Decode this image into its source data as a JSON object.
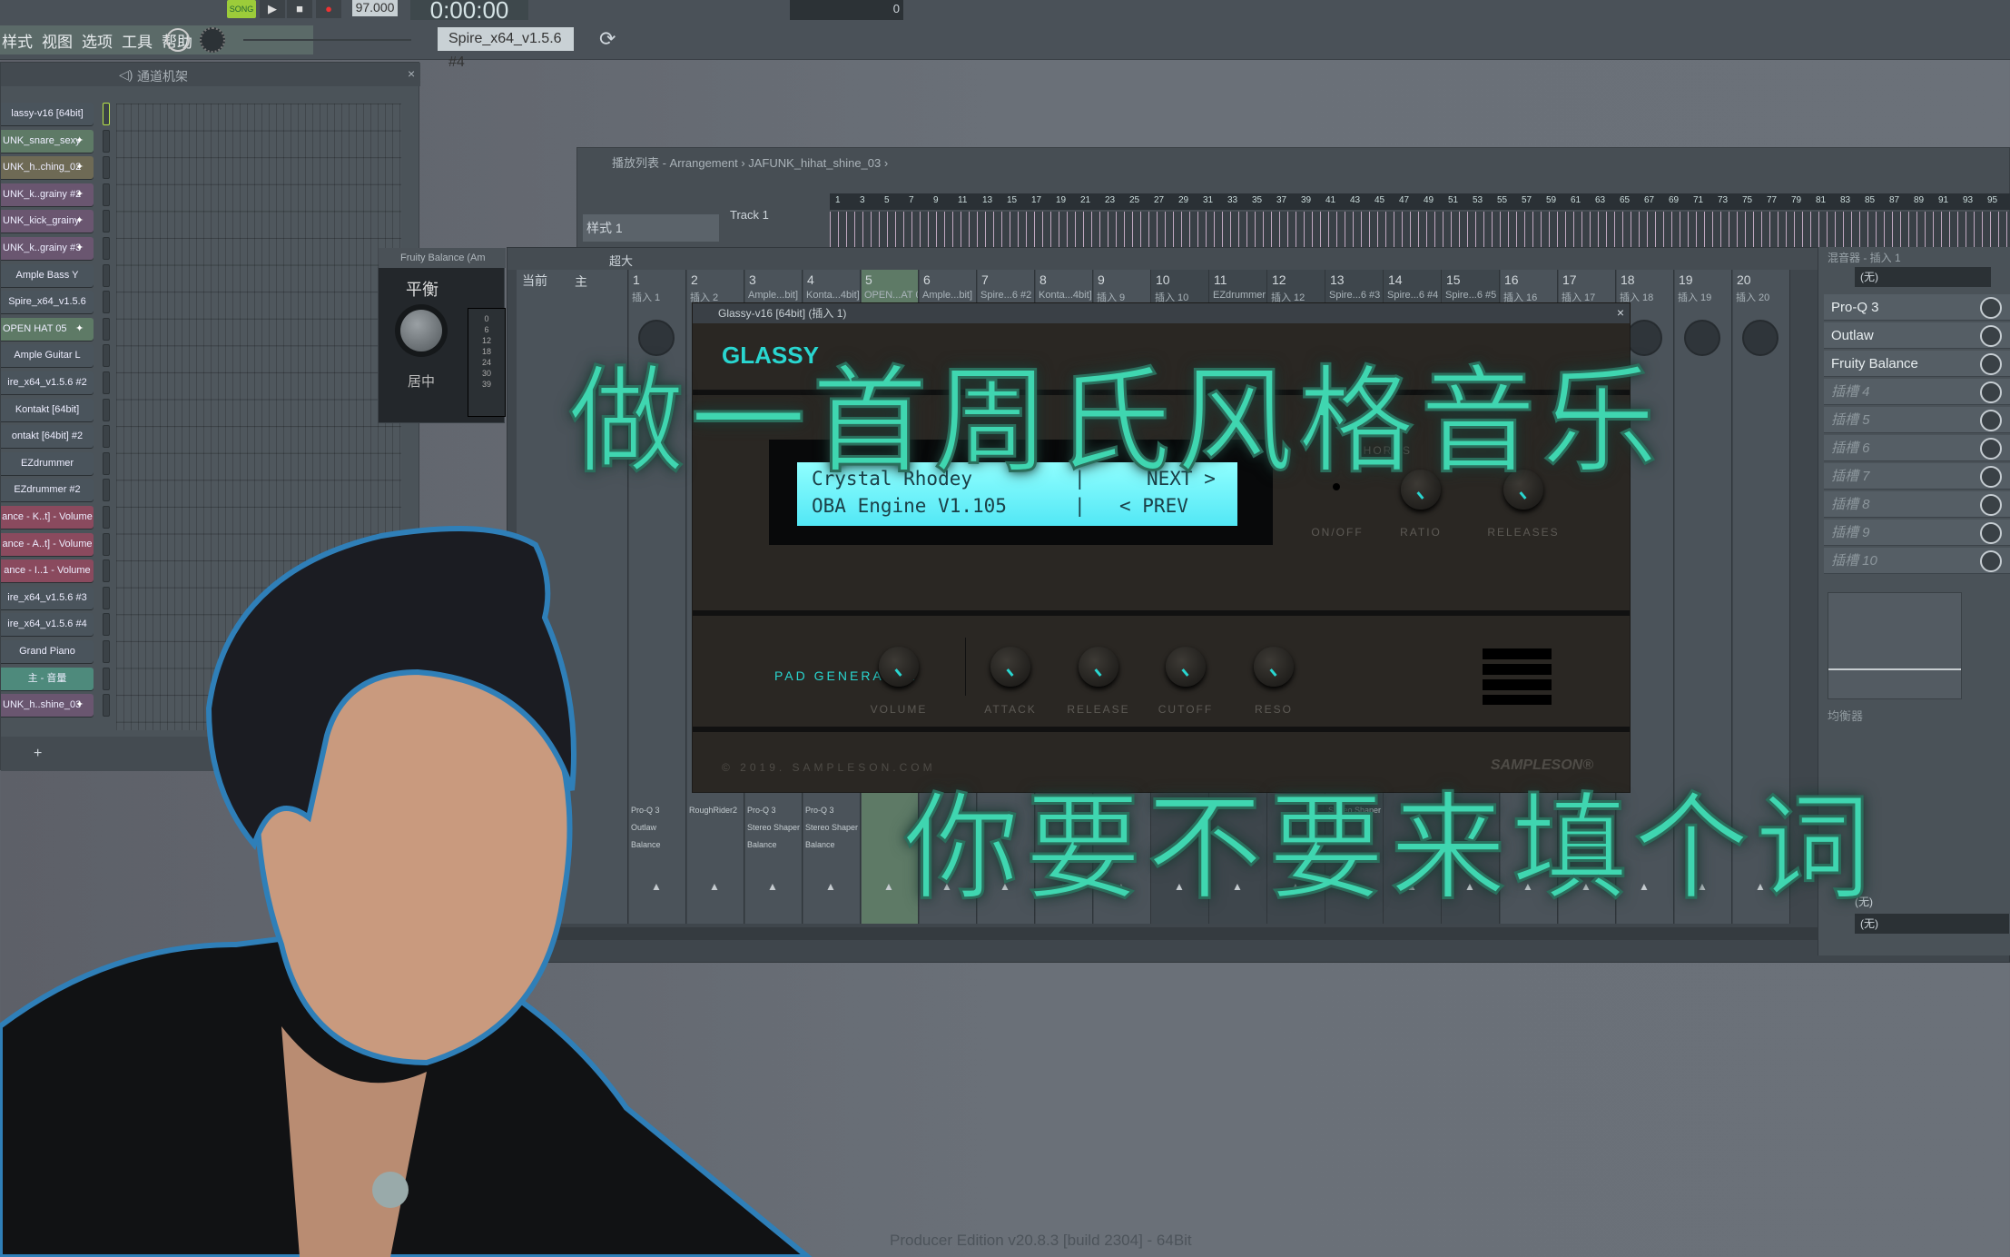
{
  "topbar": {
    "song_label": "SONG",
    "tempo": "97.000",
    "time": "0:00:00",
    "pattern": "Spire_x64_v1.5.6 #4",
    "counter": "0"
  },
  "menu": [
    "样式",
    "视图",
    "选项",
    "工具",
    "帮助"
  ],
  "channel_rack": {
    "title": "通道机架",
    "add": "+",
    "channels": [
      {
        "name": "lassy-v16 [64bit]",
        "color": "#4a545c"
      },
      {
        "name": "UNK_snare_sexy",
        "color": "#5e7a66",
        "wave": true
      },
      {
        "name": "UNK_h..ching_02",
        "color": "#6e6a55",
        "wave": true
      },
      {
        "name": "UNK_k..grainy #2",
        "color": "#6a5670",
        "wave": true
      },
      {
        "name": "UNK_kick_grainy",
        "color": "#6a5670",
        "wave": true
      },
      {
        "name": "UNK_k..grainy #3",
        "color": "#6a5670",
        "wave": true
      },
      {
        "name": "Ample Bass Y",
        "color": "#4a545c"
      },
      {
        "name": "Spire_x64_v1.5.6",
        "color": "#4a545c"
      },
      {
        "name": "OPEN HAT 05",
        "color": "#5e7a66",
        "wave": true
      },
      {
        "name": "Ample Guitar L",
        "color": "#4a545c"
      },
      {
        "name": "ire_x64_v1.5.6 #2",
        "color": "#4a545c"
      },
      {
        "name": "Kontakt [64bit]",
        "color": "#4a545c"
      },
      {
        "name": "ontakt [64bit] #2",
        "color": "#4a545c"
      },
      {
        "name": "EZdrummer",
        "color": "#4a545c"
      },
      {
        "name": "EZdrummer #2",
        "color": "#4a545c"
      },
      {
        "name": "ance - K..t] - Volume",
        "color": "#8a4a5e"
      },
      {
        "name": "ance - A..t] - Volume",
        "color": "#8a4a5e"
      },
      {
        "name": "ance - I..1 - Volume",
        "color": "#8a4a5e"
      },
      {
        "name": "ire_x64_v1.5.6 #3",
        "color": "#4a545c"
      },
      {
        "name": "ire_x64_v1.5.6 #4",
        "color": "#4a545c"
      },
      {
        "name": "Grand Piano",
        "color": "#4a545c"
      },
      {
        "name": "主 - 音量",
        "color": "#4e8a7c"
      },
      {
        "name": "UNK_h..shine_03",
        "color": "#6a5670",
        "wave": true
      }
    ]
  },
  "fruity_balance": {
    "title": "Fruity Balance (Am",
    "label": "平衡",
    "center": "居中",
    "scale": [
      "0",
      "6",
      "12",
      "18",
      "24",
      "30",
      "39"
    ]
  },
  "playlist": {
    "breadcrumb": "播放列表 - Arrangement › JAFUNK_hihat_shine_03 ›",
    "pattern": "样式 1",
    "track": "Track 1",
    "bars": [
      1,
      3,
      5,
      7,
      9,
      11,
      13,
      15,
      17,
      19,
      21,
      23,
      25,
      27,
      29,
      31,
      33,
      35,
      37,
      39,
      41,
      43,
      45,
      47,
      49,
      51,
      53,
      55,
      57,
      59,
      61,
      63,
      65,
      67,
      69,
      71,
      73,
      75,
      77,
      79,
      81,
      83,
      85,
      87,
      89,
      91,
      93,
      95
    ]
  },
  "mixer": {
    "title": "超大",
    "current": "当前",
    "master": "主",
    "tracks": [
      "插入 1",
      "插入 2",
      "Ample...bit]",
      "Konta...4bit]",
      "OPEN...AT 05",
      "Ample...bit]",
      "Spire...6 #2",
      "Konta...4bit]",
      "插入 9",
      "插入 10",
      "EZdrummer",
      "插入 12",
      "Spire...6 #3",
      "Spire...6 #4",
      "Spire...6 #5",
      "插入 16",
      "插入 17",
      "插入 18",
      "插入 19",
      "插入 20"
    ],
    "fx_master": [
      "Pro-Q 3",
      "Outlaw",
      "Balance"
    ],
    "fx2": [
      "RoughRider2"
    ],
    "fx3": [
      "Pro-Q 3",
      "Stereo Shaper",
      "Balance"
    ],
    "fx4": [
      "Pro-Q 3",
      "Stereo Shaper",
      "Balance"
    ],
    "fx13": [
      "Stereo Shaper"
    ]
  },
  "glassy": {
    "title": "Glassy-v16 [64bit] (插入 1)",
    "logo": "GLASSY",
    "lcd1": "Crystal Rhodey",
    "lcd2": "OBA Engine V1.105",
    "next": "NEXT >",
    "prev": "< PREV",
    "chorus": "CHORUS",
    "onoff": "ON/OFF",
    "ratio": "RATIO",
    "releases": "RELEASES",
    "pad": "PAD GENERATOR",
    "knobs": [
      "VOLUME",
      "ATTACK",
      "RELEASE",
      "CUTOFF",
      "RESO"
    ],
    "copyright": "© 2019. SAMPLESON.COM",
    "brand": "SAMPLESON®",
    "accent": "#29d6d0"
  },
  "inserts": {
    "title": "混音器 - 插入 1",
    "input": "(无)",
    "slots": [
      "Pro-Q 3",
      "Outlaw",
      "Fruity Balance",
      "插槽 4",
      "插槽 5",
      "插槽 6",
      "插槽 7",
      "插槽 8",
      "插槽 9",
      "插槽 10"
    ],
    "eq": "均衡器",
    "out1": "(无)",
    "out2": "(无)"
  },
  "overlay": {
    "line1": "做一首周氏风格音乐",
    "line2": "你要不要来填个词",
    "color": "#3fd6b0"
  },
  "footer": "Producer Edition v20.8.3 [build 2304] - 64Bit"
}
